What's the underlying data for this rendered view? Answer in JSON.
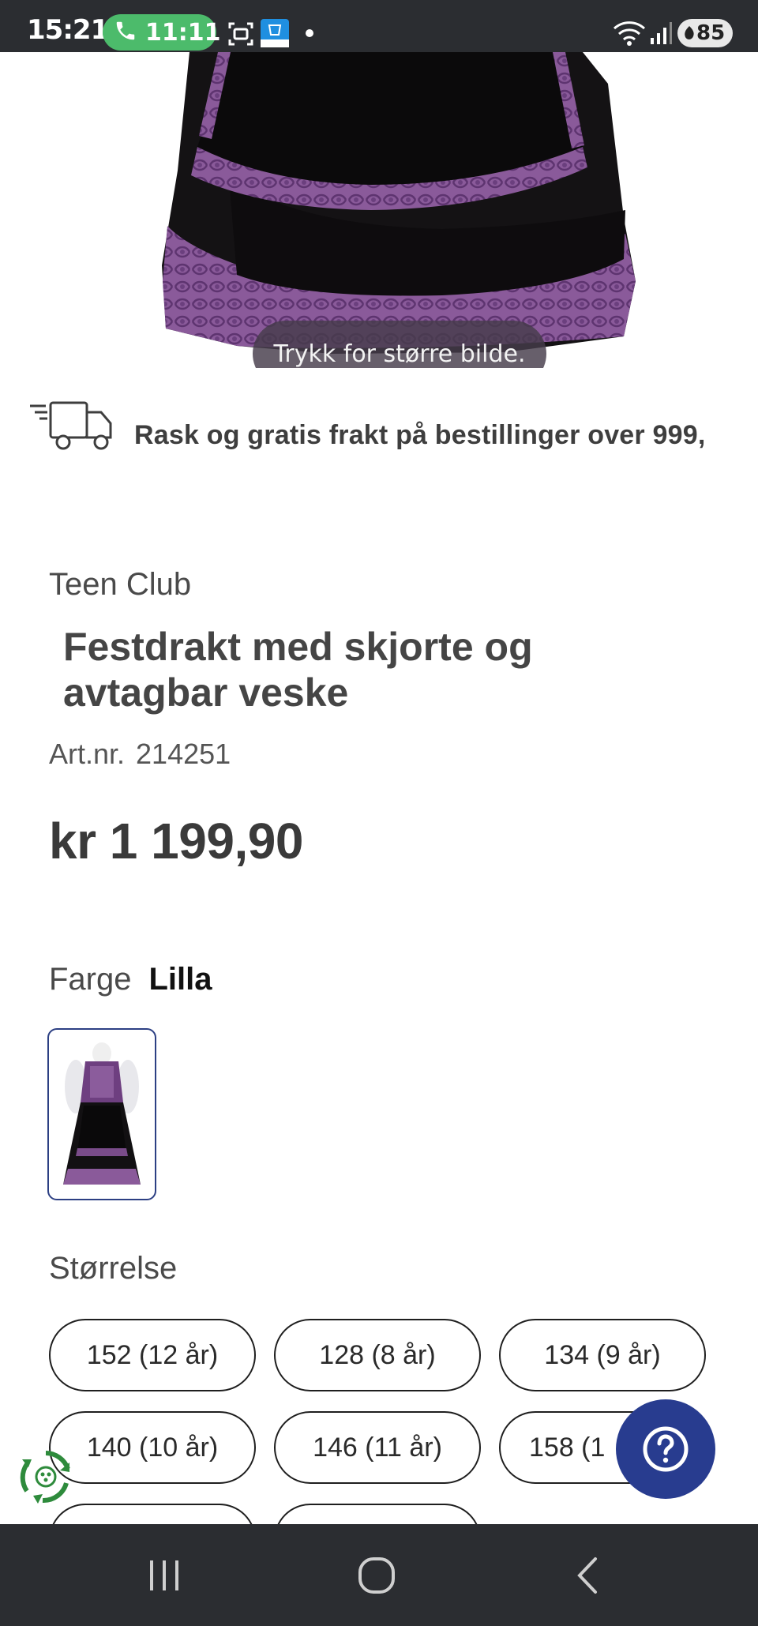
{
  "status_bar": {
    "time": "15:21",
    "call_duration": "11:11",
    "battery": "85"
  },
  "hero": {
    "toast": "Trykk for større bilde."
  },
  "shipping": {
    "text": "Rask og gratis frakt på bestillinger over 999,"
  },
  "product": {
    "brand": "Teen Club",
    "title": "Festdrakt med skjorte og avtagbar veske",
    "artnr_label": "Art.nr.",
    "artnr_value": "214251",
    "price": "kr 1 199,90"
  },
  "color": {
    "label": "Farge",
    "value": "Lilla"
  },
  "size": {
    "label": "Størrelse",
    "options": [
      "152 (12 år)",
      "128 (8 år)",
      "134 (9 år)",
      "140 (10 år)",
      "146 (11 år)",
      "158 (1"
    ]
  },
  "colors": {
    "accent": "#283c8f",
    "status_bar": "#2b2d31",
    "call_green": "#4cbb6b",
    "dress_purple": "#8a5a9a"
  }
}
